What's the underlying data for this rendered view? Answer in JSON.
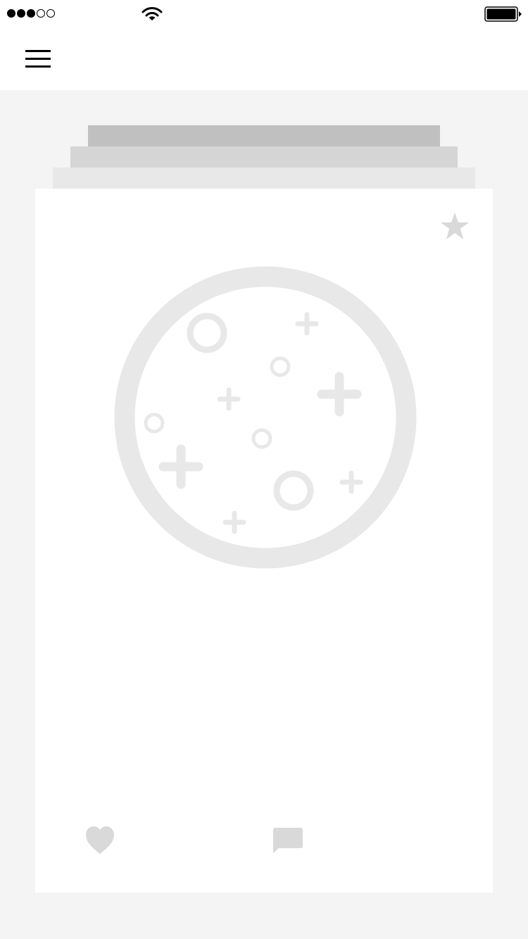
{
  "status_bar": {
    "signal_bars_filled": 3,
    "signal_bars_total": 5,
    "wifi_icon": "wifi-icon",
    "battery_icon": "battery-icon"
  },
  "nav": {
    "menu_icon": "hamburger-menu-icon"
  },
  "card": {
    "favorite_icon": "star-icon",
    "image_icon": "image-placeholder-icon",
    "like_icon": "heart-icon",
    "comment_icon": "comment-icon"
  },
  "colors": {
    "background": "#f4f4f4",
    "card": "#ffffff",
    "placeholder": "#e8e8e8",
    "icon_gray": "#d9d9d9",
    "stack_dark": "#c0c0c0",
    "stack_mid": "#d5d5d5",
    "stack_light": "#e8e8e8"
  }
}
